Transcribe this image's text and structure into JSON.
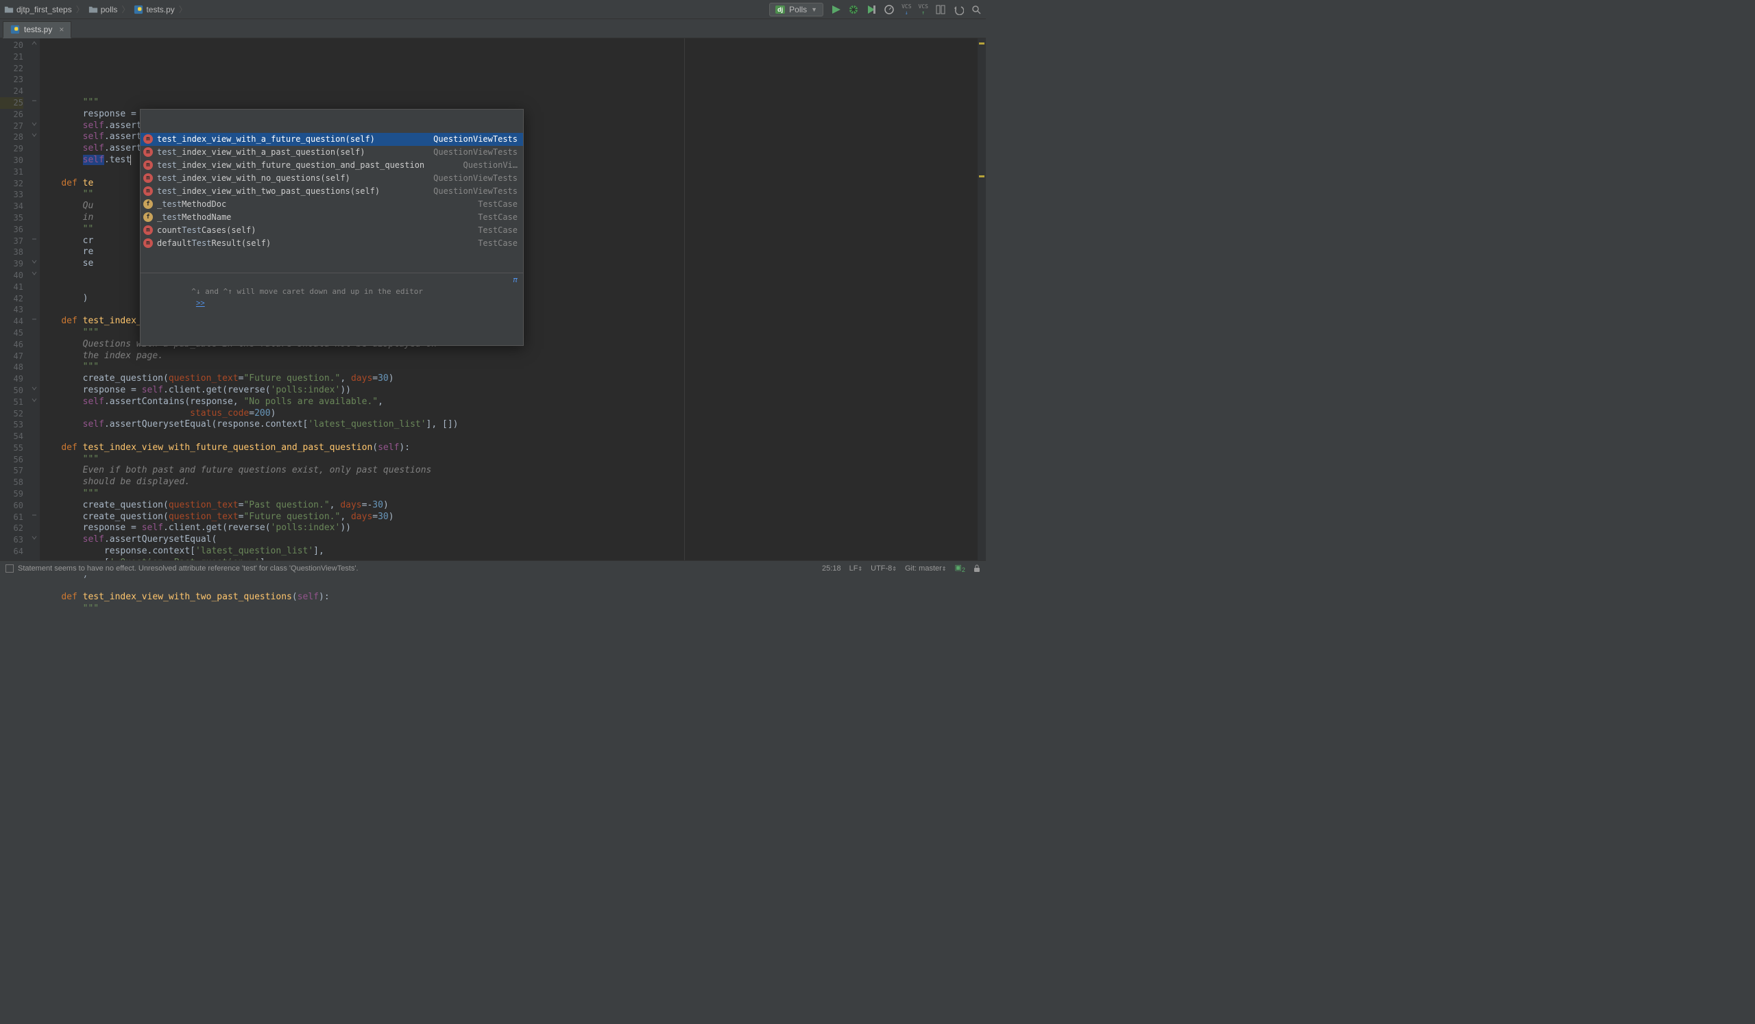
{
  "breadcrumb": {
    "project": "djtp_first_steps",
    "package": "polls",
    "file": "tests.py"
  },
  "run_config": {
    "framework_badge": "dj",
    "name": "Polls"
  },
  "tabs": [
    {
      "label": "tests.py",
      "active": true
    }
  ],
  "editor": {
    "first_line": 20,
    "lines": [
      {
        "ln": 20,
        "tokens": [
          [
            "        ",
            ""
          ],
          [
            "\"\"\"",
            "docq"
          ]
        ]
      },
      {
        "ln": 21,
        "tokens": [
          [
            "        ",
            ""
          ],
          [
            "response = ",
            ""
          ],
          [
            "self",
            "self"
          ],
          [
            ".client.get(reverse(",
            ""
          ],
          [
            "'polls:index'",
            "str"
          ],
          [
            "))",
            ""
          ]
        ]
      },
      {
        "ln": 22,
        "tokens": [
          [
            "        ",
            ""
          ],
          [
            "self",
            "self"
          ],
          [
            ".assertEqual(response.status_code, ",
            ""
          ],
          [
            "200",
            "num"
          ],
          [
            ")",
            ""
          ]
        ]
      },
      {
        "ln": 23,
        "tokens": [
          [
            "        ",
            ""
          ],
          [
            "self",
            "self"
          ],
          [
            ".assertContains(response, ",
            ""
          ],
          [
            "\"No polls are available.\"",
            "str"
          ],
          [
            ")",
            ""
          ]
        ]
      },
      {
        "ln": 24,
        "tokens": [
          [
            "        ",
            ""
          ],
          [
            "self",
            "self"
          ],
          [
            ".assertQuerysetEqual(response.context[",
            ""
          ],
          [
            "'latest_question_list'",
            "str"
          ],
          [
            "], [])",
            ""
          ]
        ]
      },
      {
        "ln": 25,
        "current": true,
        "tokens": [
          [
            "        ",
            ""
          ],
          [
            "self",
            "self hl"
          ],
          [
            ".",
            ""
          ],
          [
            "test",
            ""
          ]
        ],
        "caret": true
      },
      {
        "ln": 26,
        "tokens": [
          [
            "",
            ""
          ]
        ]
      },
      {
        "ln": 27,
        "tokens": [
          [
            "    ",
            ""
          ],
          [
            "def ",
            "kw"
          ],
          [
            "te",
            "fn"
          ]
        ]
      },
      {
        "ln": 28,
        "tokens": [
          [
            "        ",
            ""
          ],
          [
            "\"\"",
            "docq"
          ]
        ]
      },
      {
        "ln": 29,
        "tokens": [
          [
            "        ",
            ""
          ],
          [
            "Qu",
            "doc"
          ]
        ]
      },
      {
        "ln": 30,
        "tokens": [
          [
            "        ",
            ""
          ],
          [
            "in",
            "doc"
          ]
        ]
      },
      {
        "ln": 31,
        "tokens": [
          [
            "        ",
            ""
          ],
          [
            "\"\"",
            "docq"
          ]
        ]
      },
      {
        "ln": 32,
        "tokens": [
          [
            "        cr",
            ""
          ]
        ]
      },
      {
        "ln": 33,
        "tokens": [
          [
            "        re",
            ""
          ]
        ]
      },
      {
        "ln": 34,
        "tokens": [
          [
            "        se",
            ""
          ]
        ]
      },
      {
        "ln": 35,
        "tokens": [
          [
            "",
            ""
          ]
        ]
      },
      {
        "ln": 36,
        "tokens": [
          [
            "",
            ""
          ]
        ]
      },
      {
        "ln": 37,
        "tokens": [
          [
            "        )",
            ""
          ]
        ]
      },
      {
        "ln": 38,
        "tokens": [
          [
            "",
            ""
          ]
        ]
      },
      {
        "ln": 39,
        "tokens": [
          [
            "    ",
            ""
          ],
          [
            "def ",
            "kw"
          ],
          [
            "test_index_view_with_a_future_question",
            "fn"
          ],
          [
            "(",
            ""
          ],
          [
            "self",
            "self"
          ],
          [
            "):",
            ""
          ]
        ]
      },
      {
        "ln": 40,
        "tokens": [
          [
            "        ",
            ""
          ],
          [
            "\"\"\"",
            "docq"
          ]
        ]
      },
      {
        "ln": 41,
        "tokens": [
          [
            "        ",
            ""
          ],
          [
            "Questions with a pub_date in the future should not be displayed on",
            "doc"
          ]
        ]
      },
      {
        "ln": 42,
        "tokens": [
          [
            "        ",
            ""
          ],
          [
            "the index page.",
            "doc"
          ]
        ]
      },
      {
        "ln": 43,
        "tokens": [
          [
            "        ",
            ""
          ],
          [
            "\"\"\"",
            "docq"
          ]
        ]
      },
      {
        "ln": 44,
        "tokens": [
          [
            "        create_question(",
            ""
          ],
          [
            "question_text",
            "paramname"
          ],
          [
            "=",
            ""
          ],
          [
            "\"Future question.\"",
            "str"
          ],
          [
            ", ",
            ""
          ],
          [
            "days",
            "paramname"
          ],
          [
            "=",
            ""
          ],
          [
            "30",
            "num"
          ],
          [
            ")",
            ""
          ]
        ]
      },
      {
        "ln": 45,
        "tokens": [
          [
            "        response = ",
            ""
          ],
          [
            "self",
            "self"
          ],
          [
            ".client.get(reverse(",
            ""
          ],
          [
            "'polls:index'",
            "str"
          ],
          [
            "))",
            ""
          ]
        ]
      },
      {
        "ln": 46,
        "tokens": [
          [
            "        ",
            ""
          ],
          [
            "self",
            "self"
          ],
          [
            ".assertContains(response, ",
            ""
          ],
          [
            "\"No polls are available.\"",
            "str"
          ],
          [
            ",",
            ""
          ]
        ]
      },
      {
        "ln": 47,
        "tokens": [
          [
            "                            ",
            ""
          ],
          [
            "status_code",
            "paramname"
          ],
          [
            "=",
            ""
          ],
          [
            "200",
            "num"
          ],
          [
            ")",
            ""
          ]
        ]
      },
      {
        "ln": 48,
        "tokens": [
          [
            "        ",
            ""
          ],
          [
            "self",
            "self"
          ],
          [
            ".assertQuerysetEqual(response.context[",
            ""
          ],
          [
            "'latest_question_list'",
            "str"
          ],
          [
            "], [])",
            ""
          ]
        ]
      },
      {
        "ln": 49,
        "tokens": [
          [
            "",
            ""
          ]
        ]
      },
      {
        "ln": 50,
        "tokens": [
          [
            "    ",
            ""
          ],
          [
            "def ",
            "kw"
          ],
          [
            "test_index_view_with_future_question_and_past_question",
            "fn"
          ],
          [
            "(",
            ""
          ],
          [
            "self",
            "self"
          ],
          [
            "):",
            ""
          ]
        ]
      },
      {
        "ln": 51,
        "tokens": [
          [
            "        ",
            ""
          ],
          [
            "\"\"\"",
            "docq"
          ]
        ]
      },
      {
        "ln": 52,
        "tokens": [
          [
            "        ",
            ""
          ],
          [
            "Even if both past and future questions exist, only past questions",
            "doc"
          ]
        ]
      },
      {
        "ln": 53,
        "tokens": [
          [
            "        ",
            ""
          ],
          [
            "should be displayed.",
            "doc"
          ]
        ]
      },
      {
        "ln": 54,
        "tokens": [
          [
            "        ",
            ""
          ],
          [
            "\"\"\"",
            "docq"
          ]
        ]
      },
      {
        "ln": 55,
        "tokens": [
          [
            "        create_question(",
            ""
          ],
          [
            "question_text",
            "paramname"
          ],
          [
            "=",
            ""
          ],
          [
            "\"Past question.\"",
            "str"
          ],
          [
            ", ",
            ""
          ],
          [
            "days",
            "paramname"
          ],
          [
            "=-",
            ""
          ],
          [
            "30",
            "num"
          ],
          [
            ")",
            ""
          ]
        ]
      },
      {
        "ln": 56,
        "tokens": [
          [
            "        create_question(",
            ""
          ],
          [
            "question_text",
            "paramname"
          ],
          [
            "=",
            ""
          ],
          [
            "\"Future question.\"",
            "str"
          ],
          [
            ", ",
            ""
          ],
          [
            "days",
            "paramname"
          ],
          [
            "=",
            ""
          ],
          [
            "30",
            "num"
          ],
          [
            ")",
            ""
          ]
        ]
      },
      {
        "ln": 57,
        "tokens": [
          [
            "        response = ",
            ""
          ],
          [
            "self",
            "self"
          ],
          [
            ".client.get(reverse(",
            ""
          ],
          [
            "'polls:index'",
            "str"
          ],
          [
            "))",
            ""
          ]
        ]
      },
      {
        "ln": 58,
        "tokens": [
          [
            "        ",
            ""
          ],
          [
            "self",
            "self"
          ],
          [
            ".assertQuerysetEqual(",
            ""
          ]
        ]
      },
      {
        "ln": 59,
        "tokens": [
          [
            "            response.context[",
            ""
          ],
          [
            "'latest_question_list'",
            "str"
          ],
          [
            "],",
            ""
          ]
        ]
      },
      {
        "ln": 60,
        "tokens": [
          [
            "            [",
            ""
          ],
          [
            "'<Question: Past question.>'",
            "str"
          ],
          [
            "]",
            ""
          ]
        ]
      },
      {
        "ln": 61,
        "tokens": [
          [
            "        )",
            ""
          ]
        ]
      },
      {
        "ln": 62,
        "tokens": [
          [
            "",
            ""
          ]
        ]
      },
      {
        "ln": 63,
        "tokens": [
          [
            "    ",
            ""
          ],
          [
            "def ",
            "kw"
          ],
          [
            "test_index_view_with_two_past_questions",
            "fn"
          ],
          [
            "(",
            ""
          ],
          [
            "self",
            "self"
          ],
          [
            "):",
            ""
          ]
        ]
      },
      {
        "ln": 64,
        "tokens": [
          [
            "        ",
            ""
          ],
          [
            "\"\"\"",
            "docq"
          ]
        ]
      }
    ]
  },
  "completion": {
    "items": [
      {
        "badge": "m",
        "label": "test_index_view_with_a_future_question(self)",
        "type": "QuestionViewTests",
        "selected": true
      },
      {
        "badge": "m",
        "label": "test_index_view_with_a_past_question(self)",
        "type": "QuestionViewTests"
      },
      {
        "badge": "m",
        "label": "test_index_view_with_future_question_and_past_question",
        "type": "QuestionVi…"
      },
      {
        "badge": "m",
        "label": "test_index_view_with_no_questions(self)",
        "type": "QuestionViewTests"
      },
      {
        "badge": "m",
        "label": "test_index_view_with_two_past_questions(self)",
        "type": "QuestionViewTests"
      },
      {
        "badge": "f",
        "label": "_testMethodDoc",
        "type": "TestCase"
      },
      {
        "badge": "f",
        "label": "_testMethodName",
        "type": "TestCase"
      },
      {
        "badge": "m",
        "label": "countTestCases(self)",
        "type": "TestCase"
      },
      {
        "badge": "m",
        "label": "defaultTestResult(self)",
        "type": "TestCase"
      }
    ],
    "hint": "^↓ and ^↑ will move caret down and up in the editor",
    "hint_link": ">>",
    "pi": "π"
  },
  "statusbar": {
    "message": "Statement seems to have no effect. Unresolved attribute reference 'test' for class 'QuestionViewTests'.",
    "position": "25:18",
    "line_sep": "LF",
    "encoding": "UTF-8",
    "git": "Git: master",
    "trouble_count": "2"
  }
}
